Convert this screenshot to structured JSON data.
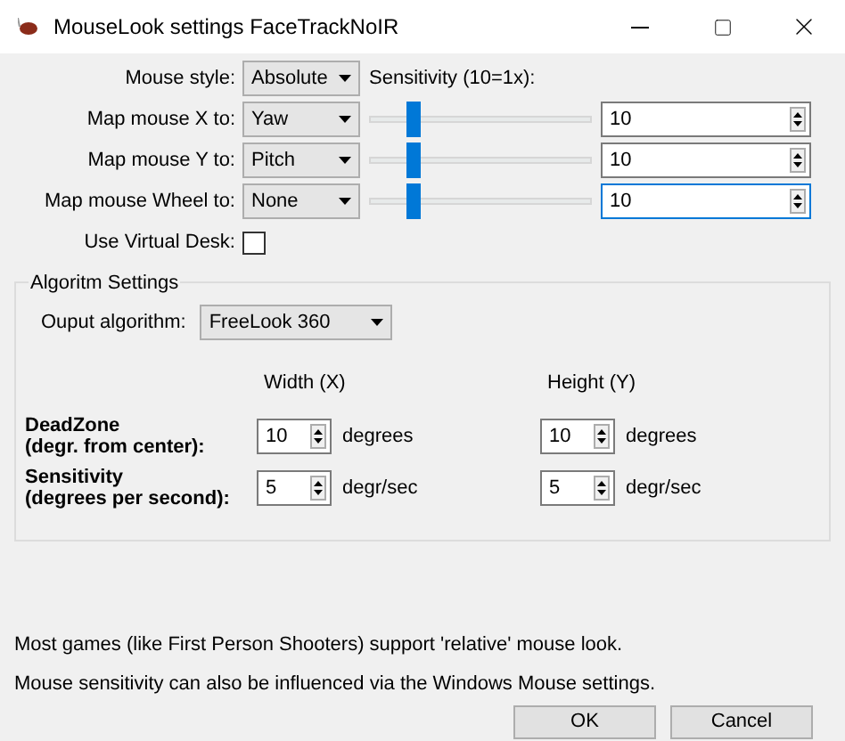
{
  "window": {
    "title": "MouseLook settings FaceTrackNoIR"
  },
  "mouse_style": {
    "label": "Mouse style:",
    "value": "Absolute"
  },
  "sensitivity_header": "Sensitivity (10=1x):",
  "mappings": [
    {
      "label": "Map mouse X to:",
      "value": "Yaw",
      "level": 0.2,
      "sensitivity": "10",
      "focused": false
    },
    {
      "label": "Map mouse Y to:",
      "value": "Pitch",
      "level": 0.2,
      "sensitivity": "10",
      "focused": false
    },
    {
      "label": "Map mouse Wheel to:",
      "value": "None",
      "level": 0.2,
      "sensitivity": "10",
      "focused": true
    }
  ],
  "virtual_desk": {
    "label": "Use Virtual Desk:",
    "checked": false
  },
  "algorithm_group": {
    "title": "Algoritm Settings",
    "output": {
      "label": "Ouput algorithm:",
      "value": "FreeLook 360"
    },
    "columns": [
      "Width (X)",
      "Height (Y)"
    ],
    "rows": [
      {
        "label": "DeadZone\n(degr. from center):",
        "cells": [
          {
            "value": "10",
            "unit": "degrees"
          },
          {
            "value": "10",
            "unit": "degrees"
          }
        ]
      },
      {
        "label": "Sensitivity\n(degrees per second):",
        "cells": [
          {
            "value": "5",
            "unit": "degr/sec"
          },
          {
            "value": "5",
            "unit": "degr/sec"
          }
        ]
      }
    ]
  },
  "notes": [
    "Most games (like First Person Shooters) support 'relative' mouse look.",
    "Mouse sensitivity can also be influenced via the Windows Mouse settings."
  ],
  "buttons": [
    "OK",
    "Cancel"
  ]
}
